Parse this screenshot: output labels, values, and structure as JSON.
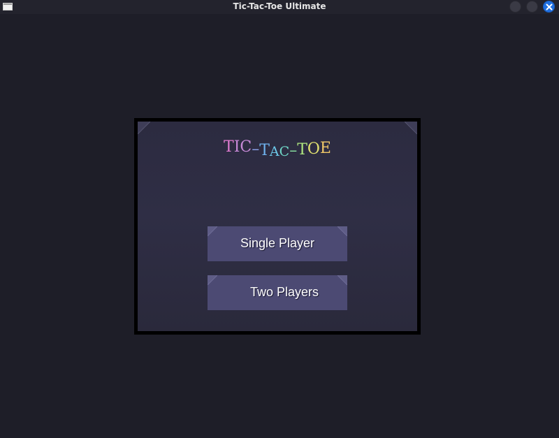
{
  "window": {
    "title": "Tic-Tac-Toe Ultimate",
    "icons": {
      "app": "window-app-icon",
      "minimize": "minimize-circle-icon",
      "maximize": "maximize-circle-icon",
      "close": "close-x-icon"
    },
    "colors": {
      "background": "#1e1e28",
      "titlebar": "#23232d",
      "close_accent": "#1f6fe0"
    }
  },
  "menu": {
    "logo": {
      "letters": [
        "T",
        "IC",
        "–",
        "T",
        "A",
        "C",
        "–",
        "T",
        "O",
        "E"
      ],
      "text": "TIC-TAC-TOE"
    },
    "buttons": {
      "single_player": "Single Player",
      "two_players": "Two Players"
    },
    "colors": {
      "frame": "#000000",
      "panel": "#2e2d44",
      "button": "#4c4a73",
      "button_text": "#ffffff"
    }
  }
}
